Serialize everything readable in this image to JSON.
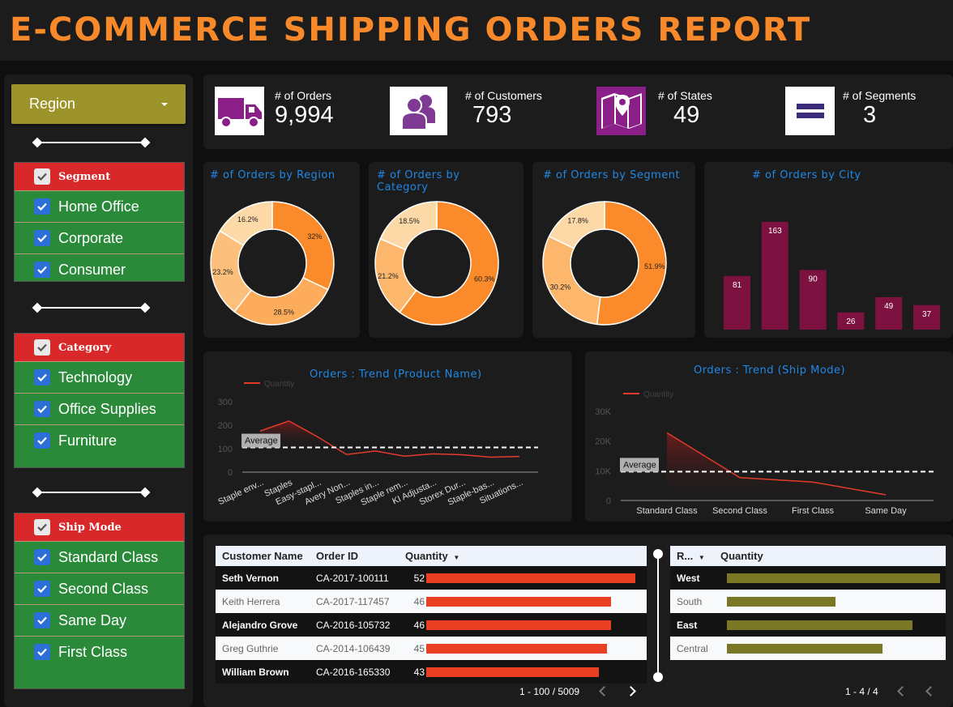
{
  "title": "E-COMMERCE SHIPPING ORDERS REPORT",
  "sidebar": {
    "region_label": "Region",
    "filters": [
      {
        "header": "Segment",
        "items": [
          "Home Office",
          "Corporate",
          "Consumer"
        ]
      },
      {
        "header": "Category",
        "items": [
          "Technology",
          "Office Supplies",
          "Furniture"
        ]
      },
      {
        "header": "Ship Mode",
        "items": [
          "Standard Class",
          "Second Class",
          "Same Day",
          "First Class"
        ]
      }
    ]
  },
  "kpis": [
    {
      "label": "# of Orders",
      "value": "9,994",
      "icon": "truck-icon"
    },
    {
      "label": "# of Customers",
      "value": "793",
      "icon": "users-icon"
    },
    {
      "label": "# of States",
      "value": "49",
      "icon": "map-pin-icon"
    },
    {
      "label": "# of Segments",
      "value": "3",
      "icon": "equals-icon"
    }
  ],
  "colors": {
    "accent": "#f7892a",
    "title_blue": "#1e88e5",
    "donut_dark": "#fb8a2a",
    "donut_mid": "#fdb76d",
    "donut_light": "#fdd9a8",
    "bar": "#7d1240",
    "table_red": "#eb3f24",
    "olive": "#7b7825",
    "green": "#2a8a3a",
    "red_head": "#d9282a"
  },
  "chart_data": [
    {
      "type": "pie",
      "title": "# of Orders by Region",
      "slices": [
        {
          "label": "32%",
          "value": 32,
          "color": "#fb8a2a"
        },
        {
          "label": "28.5%",
          "value": 28.5,
          "color": "#fdac5c"
        },
        {
          "label": "23.2%",
          "value": 23.2,
          "color": "#fdbf7c"
        },
        {
          "label": "16.2%",
          "value": 16.2,
          "color": "#fdd9a8"
        }
      ]
    },
    {
      "type": "pie",
      "title": "# of Orders by Category",
      "slices": [
        {
          "label": "60.3%",
          "value": 60.3,
          "color": "#fb8a2a"
        },
        {
          "label": "21.2%",
          "value": 21.2,
          "color": "#fdb76d"
        },
        {
          "label": "18.5%",
          "value": 18.5,
          "color": "#fdd9a8"
        }
      ]
    },
    {
      "type": "pie",
      "title": "# of Orders by Segment",
      "slices": [
        {
          "label": "51.9%",
          "value": 51.9,
          "color": "#fb8a2a"
        },
        {
          "label": "30.2%",
          "value": 30.2,
          "color": "#fdb76d"
        },
        {
          "label": "17.8%",
          "value": 17.8,
          "color": "#fdd9a8"
        }
      ]
    },
    {
      "type": "bar",
      "title": "# of Orders by City",
      "categories": [
        "",
        "",
        "",
        "",
        "",
        ""
      ],
      "values": [
        81,
        163,
        90,
        26,
        49,
        37
      ],
      "ylim": [
        0,
        180
      ]
    },
    {
      "type": "line",
      "title": "Orders : Trend (Product Name)",
      "series": [
        {
          "name": "Quantity",
          "values": [
            175,
            218,
            150,
            75,
            90,
            68,
            78,
            74,
            64,
            67
          ]
        }
      ],
      "categories": [
        "Staple env...",
        "Staples",
        "Easy-stapl...",
        "Avery Non...",
        "Staples in...",
        "Staple rem...",
        "KI Adjusta...",
        "Storex Dur...",
        "Staple-bas...",
        "Situations..."
      ],
      "yticks": [
        "300",
        "200",
        "100",
        "0"
      ],
      "ylim": [
        0,
        300
      ],
      "average": 105,
      "average_label": "Average"
    },
    {
      "type": "area",
      "title": "Orders : Trend (Ship Mode)",
      "series": [
        {
          "name": "Quantity",
          "values": [
            22800,
            7700,
            6200,
            1900
          ]
        }
      ],
      "categories": [
        "Standard Class",
        "Second Class",
        "First Class",
        "Same Day"
      ],
      "yticks": [
        "30K",
        "20K",
        "10K",
        "0"
      ],
      "ylim": [
        0,
        30000
      ],
      "average": 9700,
      "average_label": "Average"
    }
  ],
  "orders_table": {
    "headers": [
      "Customer Name",
      "Order ID",
      "Quantity"
    ],
    "rows": [
      {
        "name": "Seth Vernon",
        "id": "CA-2017-100111",
        "qty": 52
      },
      {
        "name": "Keith Herrera",
        "id": "CA-2017-117457",
        "qty": 46
      },
      {
        "name": "Alejandro Grove",
        "id": "CA-2016-105732",
        "qty": 46
      },
      {
        "name": "Greg Guthrie",
        "id": "CA-2014-106439",
        "qty": 45
      },
      {
        "name": "William Brown",
        "id": "CA-2016-165330",
        "qty": 43
      }
    ],
    "pager": "1 - 100 / 5009"
  },
  "region_table": {
    "headers": [
      "R...",
      "Quantity"
    ],
    "rows": [
      {
        "region": "West",
        "value": 1.0
      },
      {
        "region": "South",
        "value": 0.51
      },
      {
        "region": "East",
        "value": 0.87
      },
      {
        "region": "Central",
        "value": 0.73
      }
    ],
    "pager": "1 - 4 / 4"
  }
}
